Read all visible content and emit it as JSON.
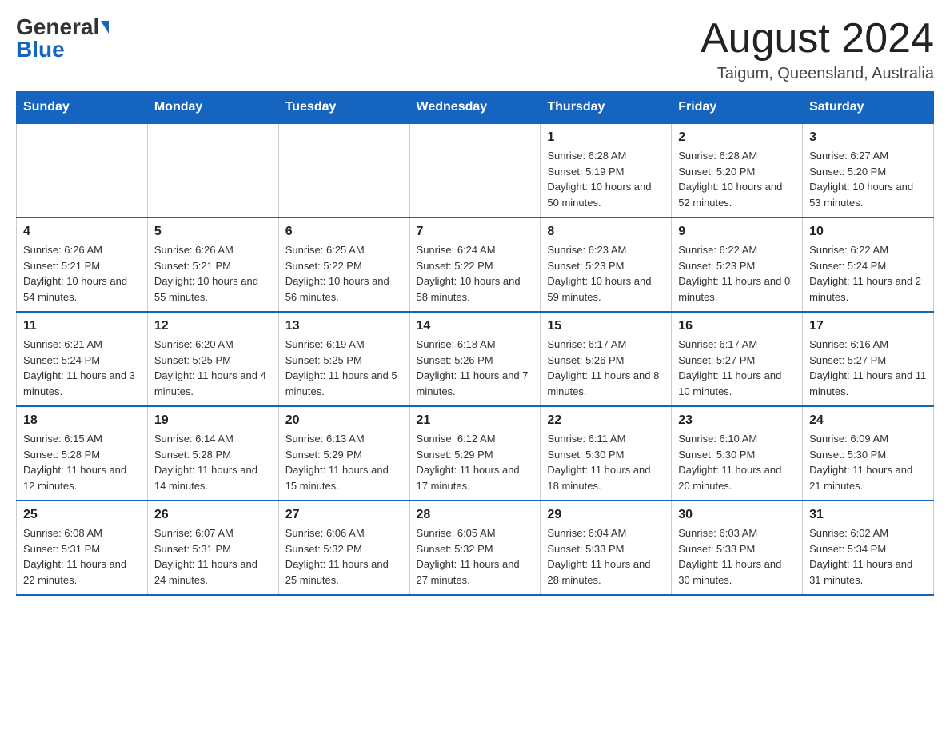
{
  "logo": {
    "general": "General",
    "blue": "Blue"
  },
  "title": "August 2024",
  "location": "Taigum, Queensland, Australia",
  "weekdays": [
    "Sunday",
    "Monday",
    "Tuesday",
    "Wednesday",
    "Thursday",
    "Friday",
    "Saturday"
  ],
  "weeks": [
    [
      {
        "day": "",
        "info": ""
      },
      {
        "day": "",
        "info": ""
      },
      {
        "day": "",
        "info": ""
      },
      {
        "day": "",
        "info": ""
      },
      {
        "day": "1",
        "info": "Sunrise: 6:28 AM\nSunset: 5:19 PM\nDaylight: 10 hours and 50 minutes."
      },
      {
        "day": "2",
        "info": "Sunrise: 6:28 AM\nSunset: 5:20 PM\nDaylight: 10 hours and 52 minutes."
      },
      {
        "day": "3",
        "info": "Sunrise: 6:27 AM\nSunset: 5:20 PM\nDaylight: 10 hours and 53 minutes."
      }
    ],
    [
      {
        "day": "4",
        "info": "Sunrise: 6:26 AM\nSunset: 5:21 PM\nDaylight: 10 hours and 54 minutes."
      },
      {
        "day": "5",
        "info": "Sunrise: 6:26 AM\nSunset: 5:21 PM\nDaylight: 10 hours and 55 minutes."
      },
      {
        "day": "6",
        "info": "Sunrise: 6:25 AM\nSunset: 5:22 PM\nDaylight: 10 hours and 56 minutes."
      },
      {
        "day": "7",
        "info": "Sunrise: 6:24 AM\nSunset: 5:22 PM\nDaylight: 10 hours and 58 minutes."
      },
      {
        "day": "8",
        "info": "Sunrise: 6:23 AM\nSunset: 5:23 PM\nDaylight: 10 hours and 59 minutes."
      },
      {
        "day": "9",
        "info": "Sunrise: 6:22 AM\nSunset: 5:23 PM\nDaylight: 11 hours and 0 minutes."
      },
      {
        "day": "10",
        "info": "Sunrise: 6:22 AM\nSunset: 5:24 PM\nDaylight: 11 hours and 2 minutes."
      }
    ],
    [
      {
        "day": "11",
        "info": "Sunrise: 6:21 AM\nSunset: 5:24 PM\nDaylight: 11 hours and 3 minutes."
      },
      {
        "day": "12",
        "info": "Sunrise: 6:20 AM\nSunset: 5:25 PM\nDaylight: 11 hours and 4 minutes."
      },
      {
        "day": "13",
        "info": "Sunrise: 6:19 AM\nSunset: 5:25 PM\nDaylight: 11 hours and 5 minutes."
      },
      {
        "day": "14",
        "info": "Sunrise: 6:18 AM\nSunset: 5:26 PM\nDaylight: 11 hours and 7 minutes."
      },
      {
        "day": "15",
        "info": "Sunrise: 6:17 AM\nSunset: 5:26 PM\nDaylight: 11 hours and 8 minutes."
      },
      {
        "day": "16",
        "info": "Sunrise: 6:17 AM\nSunset: 5:27 PM\nDaylight: 11 hours and 10 minutes."
      },
      {
        "day": "17",
        "info": "Sunrise: 6:16 AM\nSunset: 5:27 PM\nDaylight: 11 hours and 11 minutes."
      }
    ],
    [
      {
        "day": "18",
        "info": "Sunrise: 6:15 AM\nSunset: 5:28 PM\nDaylight: 11 hours and 12 minutes."
      },
      {
        "day": "19",
        "info": "Sunrise: 6:14 AM\nSunset: 5:28 PM\nDaylight: 11 hours and 14 minutes."
      },
      {
        "day": "20",
        "info": "Sunrise: 6:13 AM\nSunset: 5:29 PM\nDaylight: 11 hours and 15 minutes."
      },
      {
        "day": "21",
        "info": "Sunrise: 6:12 AM\nSunset: 5:29 PM\nDaylight: 11 hours and 17 minutes."
      },
      {
        "day": "22",
        "info": "Sunrise: 6:11 AM\nSunset: 5:30 PM\nDaylight: 11 hours and 18 minutes."
      },
      {
        "day": "23",
        "info": "Sunrise: 6:10 AM\nSunset: 5:30 PM\nDaylight: 11 hours and 20 minutes."
      },
      {
        "day": "24",
        "info": "Sunrise: 6:09 AM\nSunset: 5:30 PM\nDaylight: 11 hours and 21 minutes."
      }
    ],
    [
      {
        "day": "25",
        "info": "Sunrise: 6:08 AM\nSunset: 5:31 PM\nDaylight: 11 hours and 22 minutes."
      },
      {
        "day": "26",
        "info": "Sunrise: 6:07 AM\nSunset: 5:31 PM\nDaylight: 11 hours and 24 minutes."
      },
      {
        "day": "27",
        "info": "Sunrise: 6:06 AM\nSunset: 5:32 PM\nDaylight: 11 hours and 25 minutes."
      },
      {
        "day": "28",
        "info": "Sunrise: 6:05 AM\nSunset: 5:32 PM\nDaylight: 11 hours and 27 minutes."
      },
      {
        "day": "29",
        "info": "Sunrise: 6:04 AM\nSunset: 5:33 PM\nDaylight: 11 hours and 28 minutes."
      },
      {
        "day": "30",
        "info": "Sunrise: 6:03 AM\nSunset: 5:33 PM\nDaylight: 11 hours and 30 minutes."
      },
      {
        "day": "31",
        "info": "Sunrise: 6:02 AM\nSunset: 5:34 PM\nDaylight: 11 hours and 31 minutes."
      }
    ]
  ]
}
